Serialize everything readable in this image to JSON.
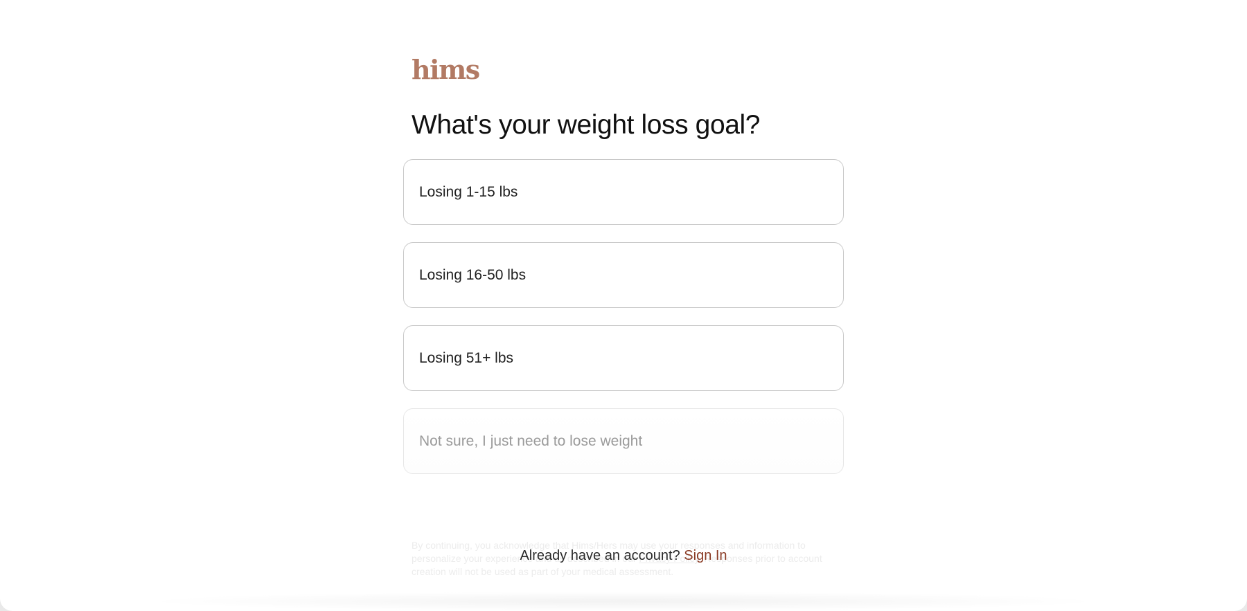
{
  "brand": {
    "logo_text": "hims",
    "accent_color": "#b27a64"
  },
  "question": {
    "title": "What's your weight loss goal?"
  },
  "options": [
    {
      "label": "Losing 1-15 lbs"
    },
    {
      "label": "Losing 16-50 lbs"
    },
    {
      "label": "Losing 51+ lbs"
    },
    {
      "label": "Not sure, I just need to lose weight"
    }
  ],
  "footer": {
    "disclaimer_start": "By continuing, you acknowledge that Hims/Hers may use your responses and information to personalize your experience and as described in our",
    "privacy_link": "Privacy Policy",
    "disclaimer_end": ". Responses prior to account creation will not be used as part of your medical assessment.",
    "prompt": "Already have an account?",
    "signin_link": "Sign In",
    "link_color": "#8a3b25"
  }
}
